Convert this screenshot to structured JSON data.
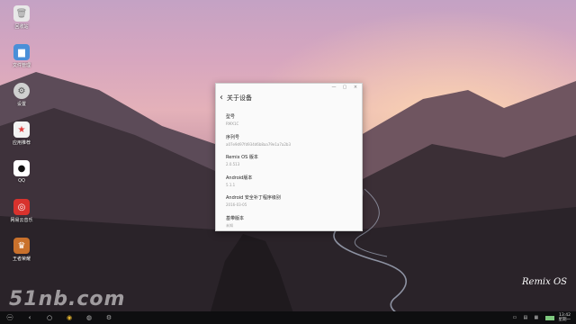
{
  "desktop_icons": [
    {
      "label": "回收站",
      "icon": "trash-icon",
      "color": "#e8e8e8"
    },
    {
      "label": "文件管理",
      "icon": "folder-icon",
      "color": "#4a8fd8"
    },
    {
      "label": "设置",
      "icon": "gear-icon",
      "color": "#d0d0d0"
    },
    {
      "label": "应用推荐",
      "icon": "store-icon",
      "color": "#f3f3f3"
    },
    {
      "label": "QQ",
      "icon": "qq-icon",
      "color": "#ffffff"
    },
    {
      "label": "网易云音乐",
      "icon": "music-icon",
      "color": "#d8322d"
    },
    {
      "label": "王者荣耀",
      "icon": "game-icon",
      "color": "#c9712c"
    }
  ],
  "window": {
    "back_glyph": "‹",
    "title": "关于设备",
    "controls": [
      "—",
      "▢",
      "×"
    ],
    "rows": [
      {
        "title": "型号",
        "value": "RMX1C"
      },
      {
        "title": "序列号",
        "value": "a07e9d97fd934d6b8aa79e1a7a2b3"
      },
      {
        "title": "Remix OS 版本",
        "value": "2.0.513"
      },
      {
        "title": "Android版本",
        "value": "5.1.1"
      },
      {
        "title": "Android 安全补丁程序级别",
        "value": "2016-03-05"
      },
      {
        "title": "基带版本",
        "value": "未知"
      }
    ]
  },
  "watermark": "51nb.com",
  "brand_logo": "Remix OS",
  "taskbar": {
    "start_glyph": "㊀",
    "items": [
      "‹",
      "○",
      "◉",
      "◍",
      "⚙"
    ],
    "clock_time": "13:42",
    "clock_date": "星期一",
    "battery_level": 1.0
  }
}
